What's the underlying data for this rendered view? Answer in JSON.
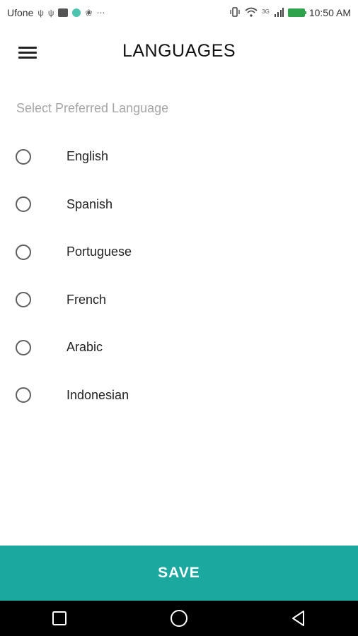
{
  "status_bar": {
    "carrier": "Ufone",
    "time": "10:50 AM",
    "network": "3G",
    "left_icons": [
      "usb-icon",
      "usb-icon",
      "app-icon",
      "app-dot-icon",
      "settings-icon",
      "more-icon"
    ],
    "right_icons": [
      "vibrate-icon",
      "wifi-icon",
      "signal-icon",
      "battery-icon"
    ]
  },
  "header": {
    "title": "LANGUAGES",
    "menu_icon": "hamburger-menu-icon"
  },
  "subtitle": "Select Preferred Language",
  "languages": [
    {
      "label": "English",
      "selected": false
    },
    {
      "label": "Spanish",
      "selected": false
    },
    {
      "label": "Portuguese",
      "selected": false
    },
    {
      "label": "French",
      "selected": false
    },
    {
      "label": "Arabic",
      "selected": false
    },
    {
      "label": "Indonesian",
      "selected": false
    }
  ],
  "save_button": {
    "label": "SAVE",
    "color": "#1ba99f"
  },
  "nav_bar": {
    "buttons": [
      "recents-square-icon",
      "home-circle-icon",
      "back-triangle-icon"
    ]
  }
}
